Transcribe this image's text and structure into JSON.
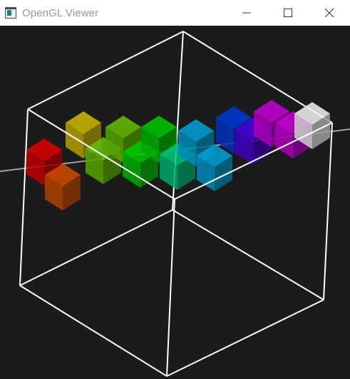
{
  "window": {
    "title": "OpenGL Viewer",
    "icon": "opengl-app-icon",
    "controls": [
      "minimize-icon",
      "maximize-icon",
      "close-icon"
    ]
  },
  "scene": {
    "background": "#1b1b1b",
    "wire_color": "#ffffff",
    "axis_color": "#a0a0a0",
    "cube_colors": [
      "#c40000",
      "#b84400",
      "#b8a600",
      "#5aaa00",
      "#00b300",
      "#00b070",
      "#0090c0",
      "#0033c0",
      "#4400c0",
      "#b000c0",
      "#d8d8d8"
    ]
  }
}
